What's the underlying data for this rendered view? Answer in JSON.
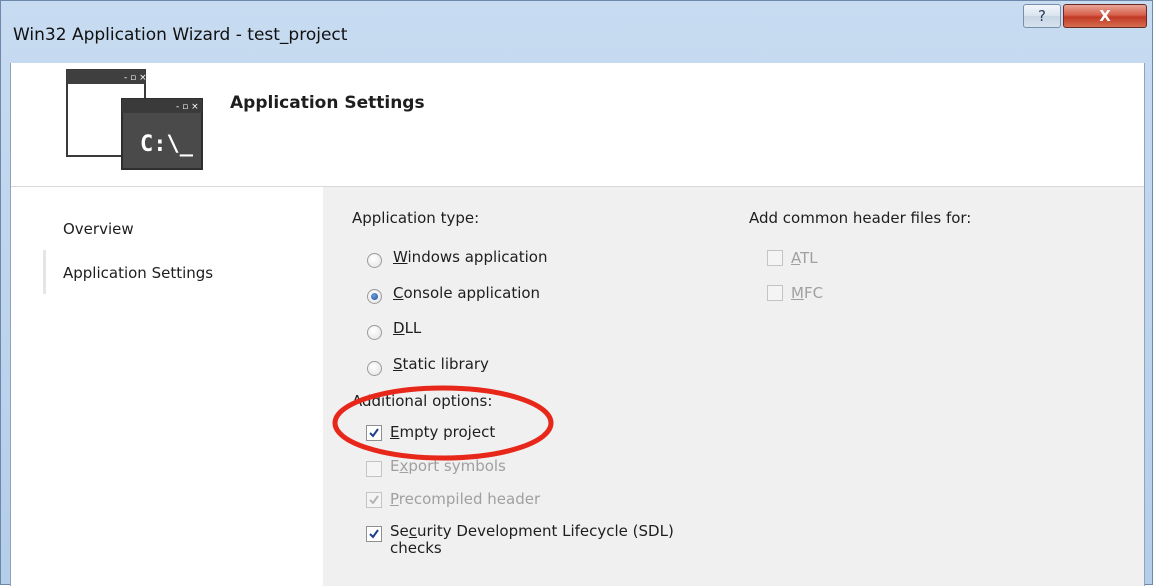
{
  "window": {
    "title": "Win32 Application Wizard - test_project",
    "help_glyph": "?",
    "close_glyph": "X"
  },
  "header": {
    "title": "Application Settings",
    "icon_caption": "C:\\_",
    "icon": "console-window-icon"
  },
  "nav": {
    "items": [
      {
        "label": "Overview"
      },
      {
        "label": "Application Settings",
        "active": true
      }
    ]
  },
  "application_type": {
    "heading": "Application type:",
    "options": [
      {
        "pre": "",
        "mnemonic": "W",
        "rest": "indows application",
        "selected": false
      },
      {
        "pre": "",
        "mnemonic": "C",
        "rest": "onsole application",
        "selected": true
      },
      {
        "pre": "",
        "mnemonic": "D",
        "rest": "LL",
        "selected": false
      },
      {
        "pre": "",
        "mnemonic": "S",
        "rest": "tatic library",
        "selected": false
      }
    ]
  },
  "additional_options": {
    "heading": "Additional options:",
    "options": [
      {
        "pre": "",
        "mnemonic": "E",
        "rest": "mpty project",
        "checked": true,
        "enabled": true
      },
      {
        "pre": "E",
        "mnemonic": "x",
        "rest": "port symbols",
        "checked": false,
        "enabled": false
      },
      {
        "pre": "",
        "mnemonic": "P",
        "rest": "recompiled header",
        "checked": true,
        "enabled": false
      },
      {
        "pre": "Se",
        "mnemonic": "c",
        "rest": "urity Development Lifecycle (SDL)",
        "line2": "checks",
        "checked": true,
        "enabled": true
      }
    ]
  },
  "common_headers": {
    "heading": "Add common header files for:",
    "options": [
      {
        "pre": "",
        "mnemonic": "A",
        "rest": "TL",
        "checked": false,
        "enabled": false
      },
      {
        "pre": "",
        "mnemonic": "M",
        "rest": "FC",
        "checked": false,
        "enabled": false
      }
    ]
  },
  "annotation": {
    "shape": "ellipse",
    "color": "#e8271b",
    "target": "Empty project"
  },
  "colors": {
    "titlebar": "#c7dbf1",
    "content_background": "#f0f0f0",
    "close_button": "#c23a25",
    "disabled_text": "#a0a0a0"
  }
}
